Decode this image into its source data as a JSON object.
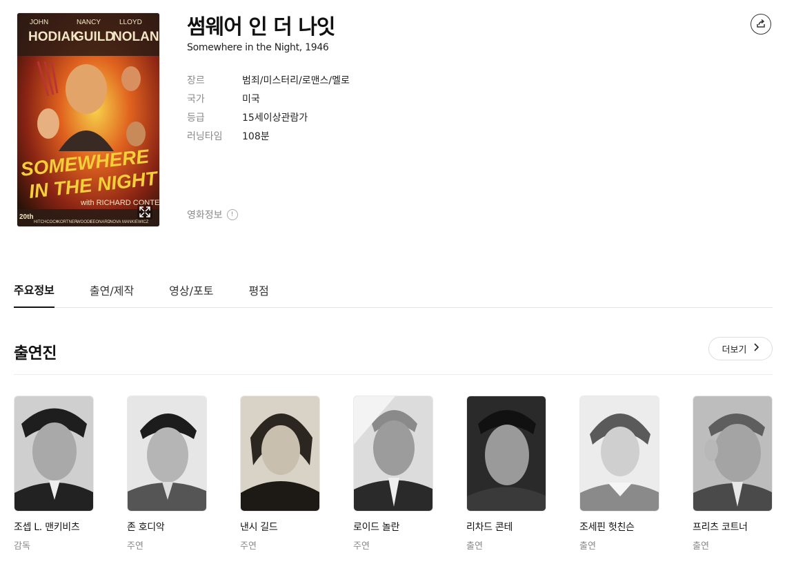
{
  "movie": {
    "title": "썸웨어 인 더 나잇",
    "subtitle": "Somewhere in the Night, 1946",
    "info": [
      {
        "label": "장르",
        "value": "범죄/미스터리/로맨스/멜로"
      },
      {
        "label": "국가",
        "value": "미국"
      },
      {
        "label": "등급",
        "value": "15세이상관람가"
      },
      {
        "label": "러닝타임",
        "value": "108분"
      }
    ],
    "movie_info_link": "영화정보",
    "poster": {
      "credit_names": [
        "JOHN",
        "NANCY",
        "LLOYD"
      ],
      "credit_surnames": [
        "HODIAK",
        "GUILD",
        "NOLAN"
      ],
      "title_line1": "SOMEWHERE",
      "title_line2": "IN THE NIGHT",
      "with_text": "with RICHARD CONTE",
      "studio": "20th",
      "bottom_names": [
        "HITCHCOCK",
        "KORTNER",
        "WOODE",
        "LEONARD",
        "NOVA",
        "MANKIEWICZ"
      ]
    }
  },
  "tabs": [
    {
      "label": "주요정보",
      "active": true
    },
    {
      "label": "출연/제작",
      "active": false
    },
    {
      "label": "영상/포토",
      "active": false
    },
    {
      "label": "평점",
      "active": false
    }
  ],
  "cast_section": {
    "title": "출연진",
    "more_label": "더보기",
    "members": [
      {
        "name": "조셉 L. 맨키비츠",
        "role": "감독"
      },
      {
        "name": "존 호디악",
        "role": "주연"
      },
      {
        "name": "낸시 길드",
        "role": "주연"
      },
      {
        "name": "로이드 놀란",
        "role": "주연"
      },
      {
        "name": "리차드 콘테",
        "role": "출연"
      },
      {
        "name": "조세핀 헛친슨",
        "role": "출연"
      },
      {
        "name": "프리츠 코트너",
        "role": "출연"
      }
    ]
  },
  "colors": {
    "poster_bg": "#2a1a10",
    "poster_title": "#f3cf3a",
    "poster_red": "#c9301f",
    "tab_active_underline": "#111111",
    "muted_text": "#8a8a8a"
  },
  "icons": {
    "share": "share-icon",
    "expand": "expand-icon",
    "info": "info-icon",
    "more_chevron": "chevron-right-icon"
  }
}
